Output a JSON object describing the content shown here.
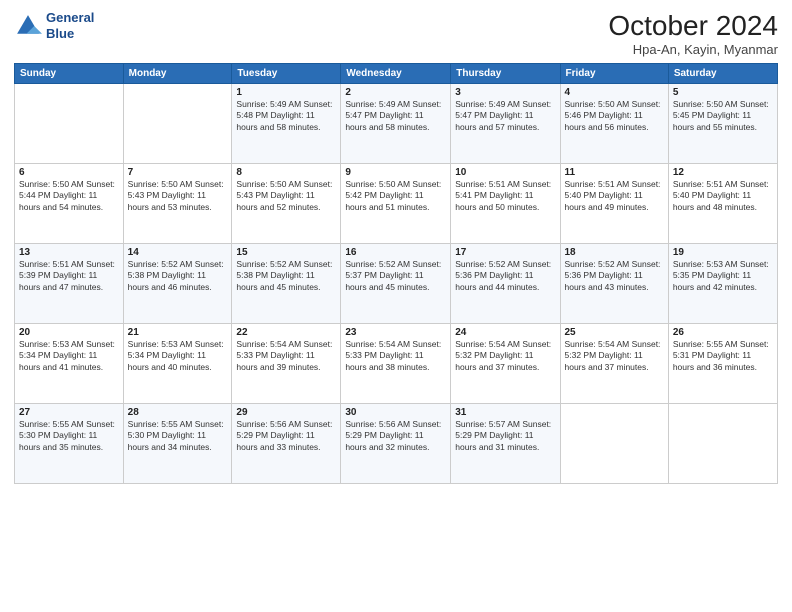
{
  "header": {
    "logo_line1": "General",
    "logo_line2": "Blue",
    "month_title": "October 2024",
    "location": "Hpa-An, Kayin, Myanmar"
  },
  "columns": [
    "Sunday",
    "Monday",
    "Tuesday",
    "Wednesday",
    "Thursday",
    "Friday",
    "Saturday"
  ],
  "weeks": [
    [
      {
        "day": "",
        "info": ""
      },
      {
        "day": "",
        "info": ""
      },
      {
        "day": "1",
        "info": "Sunrise: 5:49 AM\nSunset: 5:48 PM\nDaylight: 11 hours and 58 minutes."
      },
      {
        "day": "2",
        "info": "Sunrise: 5:49 AM\nSunset: 5:47 PM\nDaylight: 11 hours and 58 minutes."
      },
      {
        "day": "3",
        "info": "Sunrise: 5:49 AM\nSunset: 5:47 PM\nDaylight: 11 hours and 57 minutes."
      },
      {
        "day": "4",
        "info": "Sunrise: 5:50 AM\nSunset: 5:46 PM\nDaylight: 11 hours and 56 minutes."
      },
      {
        "day": "5",
        "info": "Sunrise: 5:50 AM\nSunset: 5:45 PM\nDaylight: 11 hours and 55 minutes."
      }
    ],
    [
      {
        "day": "6",
        "info": "Sunrise: 5:50 AM\nSunset: 5:44 PM\nDaylight: 11 hours and 54 minutes."
      },
      {
        "day": "7",
        "info": "Sunrise: 5:50 AM\nSunset: 5:43 PM\nDaylight: 11 hours and 53 minutes."
      },
      {
        "day": "8",
        "info": "Sunrise: 5:50 AM\nSunset: 5:43 PM\nDaylight: 11 hours and 52 minutes."
      },
      {
        "day": "9",
        "info": "Sunrise: 5:50 AM\nSunset: 5:42 PM\nDaylight: 11 hours and 51 minutes."
      },
      {
        "day": "10",
        "info": "Sunrise: 5:51 AM\nSunset: 5:41 PM\nDaylight: 11 hours and 50 minutes."
      },
      {
        "day": "11",
        "info": "Sunrise: 5:51 AM\nSunset: 5:40 PM\nDaylight: 11 hours and 49 minutes."
      },
      {
        "day": "12",
        "info": "Sunrise: 5:51 AM\nSunset: 5:40 PM\nDaylight: 11 hours and 48 minutes."
      }
    ],
    [
      {
        "day": "13",
        "info": "Sunrise: 5:51 AM\nSunset: 5:39 PM\nDaylight: 11 hours and 47 minutes."
      },
      {
        "day": "14",
        "info": "Sunrise: 5:52 AM\nSunset: 5:38 PM\nDaylight: 11 hours and 46 minutes."
      },
      {
        "day": "15",
        "info": "Sunrise: 5:52 AM\nSunset: 5:38 PM\nDaylight: 11 hours and 45 minutes."
      },
      {
        "day": "16",
        "info": "Sunrise: 5:52 AM\nSunset: 5:37 PM\nDaylight: 11 hours and 45 minutes."
      },
      {
        "day": "17",
        "info": "Sunrise: 5:52 AM\nSunset: 5:36 PM\nDaylight: 11 hours and 44 minutes."
      },
      {
        "day": "18",
        "info": "Sunrise: 5:52 AM\nSunset: 5:36 PM\nDaylight: 11 hours and 43 minutes."
      },
      {
        "day": "19",
        "info": "Sunrise: 5:53 AM\nSunset: 5:35 PM\nDaylight: 11 hours and 42 minutes."
      }
    ],
    [
      {
        "day": "20",
        "info": "Sunrise: 5:53 AM\nSunset: 5:34 PM\nDaylight: 11 hours and 41 minutes."
      },
      {
        "day": "21",
        "info": "Sunrise: 5:53 AM\nSunset: 5:34 PM\nDaylight: 11 hours and 40 minutes."
      },
      {
        "day": "22",
        "info": "Sunrise: 5:54 AM\nSunset: 5:33 PM\nDaylight: 11 hours and 39 minutes."
      },
      {
        "day": "23",
        "info": "Sunrise: 5:54 AM\nSunset: 5:33 PM\nDaylight: 11 hours and 38 minutes."
      },
      {
        "day": "24",
        "info": "Sunrise: 5:54 AM\nSunset: 5:32 PM\nDaylight: 11 hours and 37 minutes."
      },
      {
        "day": "25",
        "info": "Sunrise: 5:54 AM\nSunset: 5:32 PM\nDaylight: 11 hours and 37 minutes."
      },
      {
        "day": "26",
        "info": "Sunrise: 5:55 AM\nSunset: 5:31 PM\nDaylight: 11 hours and 36 minutes."
      }
    ],
    [
      {
        "day": "27",
        "info": "Sunrise: 5:55 AM\nSunset: 5:30 PM\nDaylight: 11 hours and 35 minutes."
      },
      {
        "day": "28",
        "info": "Sunrise: 5:55 AM\nSunset: 5:30 PM\nDaylight: 11 hours and 34 minutes."
      },
      {
        "day": "29",
        "info": "Sunrise: 5:56 AM\nSunset: 5:29 PM\nDaylight: 11 hours and 33 minutes."
      },
      {
        "day": "30",
        "info": "Sunrise: 5:56 AM\nSunset: 5:29 PM\nDaylight: 11 hours and 32 minutes."
      },
      {
        "day": "31",
        "info": "Sunrise: 5:57 AM\nSunset: 5:29 PM\nDaylight: 11 hours and 31 minutes."
      },
      {
        "day": "",
        "info": ""
      },
      {
        "day": "",
        "info": ""
      }
    ]
  ]
}
